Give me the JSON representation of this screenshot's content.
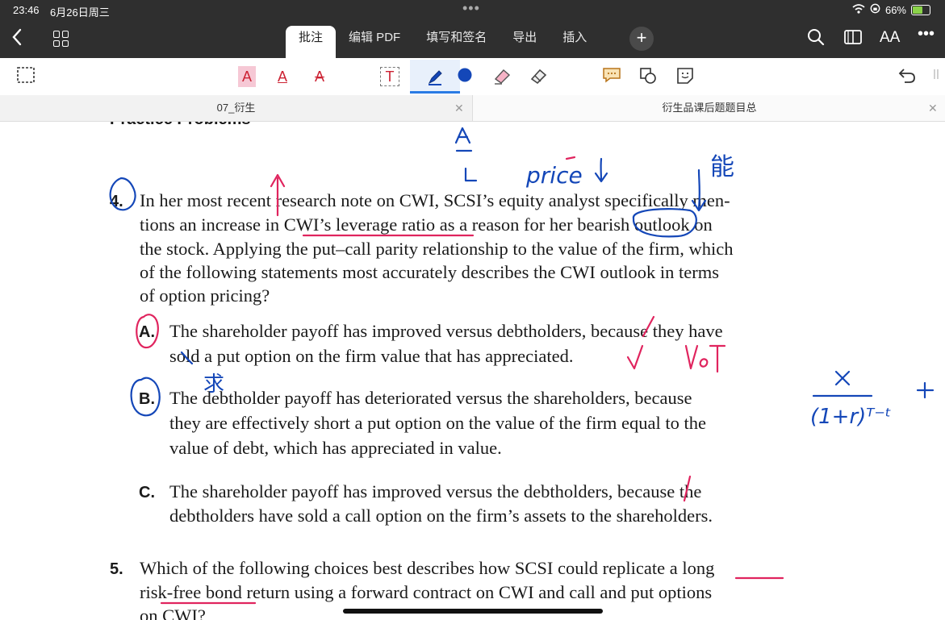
{
  "status": {
    "time": "23:46",
    "date": "6月26日周三",
    "dots": "•••",
    "battery": "66%",
    "battery_level": 0.66
  },
  "appbar": {
    "tabs": [
      {
        "label": "批注"
      },
      {
        "label": "编辑 PDF"
      },
      {
        "label": "填写和签名"
      },
      {
        "label": "导出"
      },
      {
        "label": "插入"
      }
    ],
    "plus": "+",
    "font_size_label": "AA",
    "more": "•••"
  },
  "toolbar": {
    "text_highlight": "A",
    "text_underline": "A",
    "text_strike": "A",
    "text_box": "T",
    "icons": [
      "selection-icon",
      "highlight-text-icon",
      "underline-text-icon",
      "strikethrough-text-icon",
      "textbox-icon",
      "pen-icon",
      "color-dot-icon",
      "highlighter-icon",
      "eraser-icon",
      "comment-icon",
      "shapes-icon",
      "sticker-icon",
      "undo-icon"
    ],
    "pen_color": "#1447b8"
  },
  "doc_tabs": [
    {
      "title": "07_衍生"
    },
    {
      "title": "衍生品课后题题目总"
    }
  ],
  "document": {
    "heading_cut": "Practice Problems",
    "q4": {
      "number": "4.",
      "lines": [
        "In her most recent research note on CWI, SCSI’s equity analyst specifically men-",
        "tions an increase in CWI’s leverage ratio as a reason for her bearish outlook on",
        "the stock. Applying the put–call parity relationship to the value of the firm, which",
        "of the following statements most accurately describes the CWI outlook in terms",
        "of option pricing?"
      ],
      "options": [
        {
          "label": "A.",
          "lines": [
            "The shareholder payoff has improved versus debtholders, because they have",
            "sold a put option on the firm value that has appreciated."
          ]
        },
        {
          "label": "B.",
          "lines": [
            "The debtholder payoff has deteriorated versus the shareholders, because",
            "they are effectively short a put option on the value of the firm equal to the",
            "value of debt, which has appreciated in value."
          ]
        },
        {
          "label": "C.",
          "lines": [
            "The shareholder payoff has improved versus the debtholders, because the",
            "debtholders have sold a call option on the firm’s assets to the shareholders."
          ]
        }
      ]
    },
    "q5": {
      "number": "5.",
      "lines": [
        "Which of the following choices best describes how SCSI could replicate a long",
        "risk-free bond return using a forward contract on CWI and call and put options",
        "on CWI?"
      ]
    }
  },
  "annotations": {
    "handwriting": [
      "A",
      "L",
      "price↓",
      "求",
      "V₀T",
      "X",
      "(1+r)ᵀ⁻ᵗ",
      "+"
    ],
    "colors": {
      "blue": "#1447b8",
      "red": "#e0245e"
    }
  }
}
